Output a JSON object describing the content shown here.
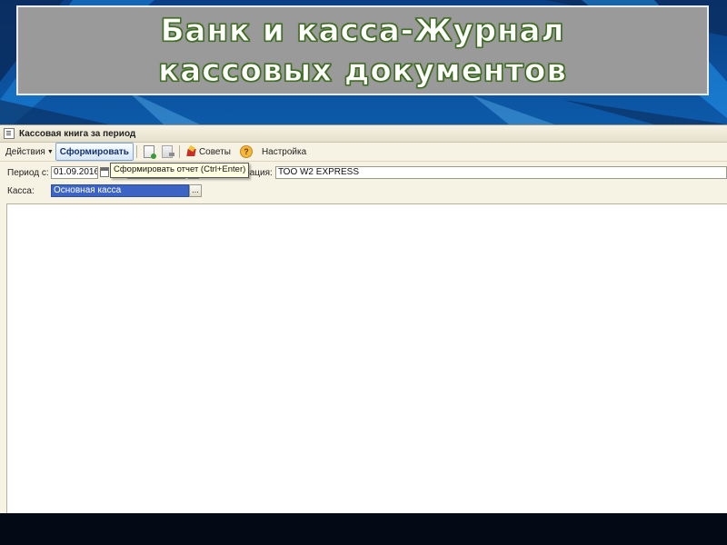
{
  "slide": {
    "title": "Банк и касса-Журнал кассовых документов"
  },
  "window": {
    "title": "Кассовая книга за период",
    "icon": "report-window-icon"
  },
  "toolbar": {
    "actions_label": "Действия",
    "form_label": "Сформировать",
    "tips_label": "Советы",
    "settings_label": "Настройка"
  },
  "tooltip": {
    "text": "Сформировать отчет (Ctrl+Enter)"
  },
  "form": {
    "period_label": "Период с:",
    "period_from": "01.09.2016",
    "org_label": "низация:",
    "org_value": "ТОО W2 EXPRESS",
    "cash_label": "Касса:",
    "cash_value": "Основная касса",
    "ellipsis": "..."
  },
  "colors": {
    "slide_bg": "#0f6fc4",
    "title_box": "#9a9a9a",
    "title_outline": "#3f6e22",
    "window_bg": "#f7f3e4",
    "selected_field": "#3d64c4",
    "tooltip_bg": "#ffffe1"
  }
}
